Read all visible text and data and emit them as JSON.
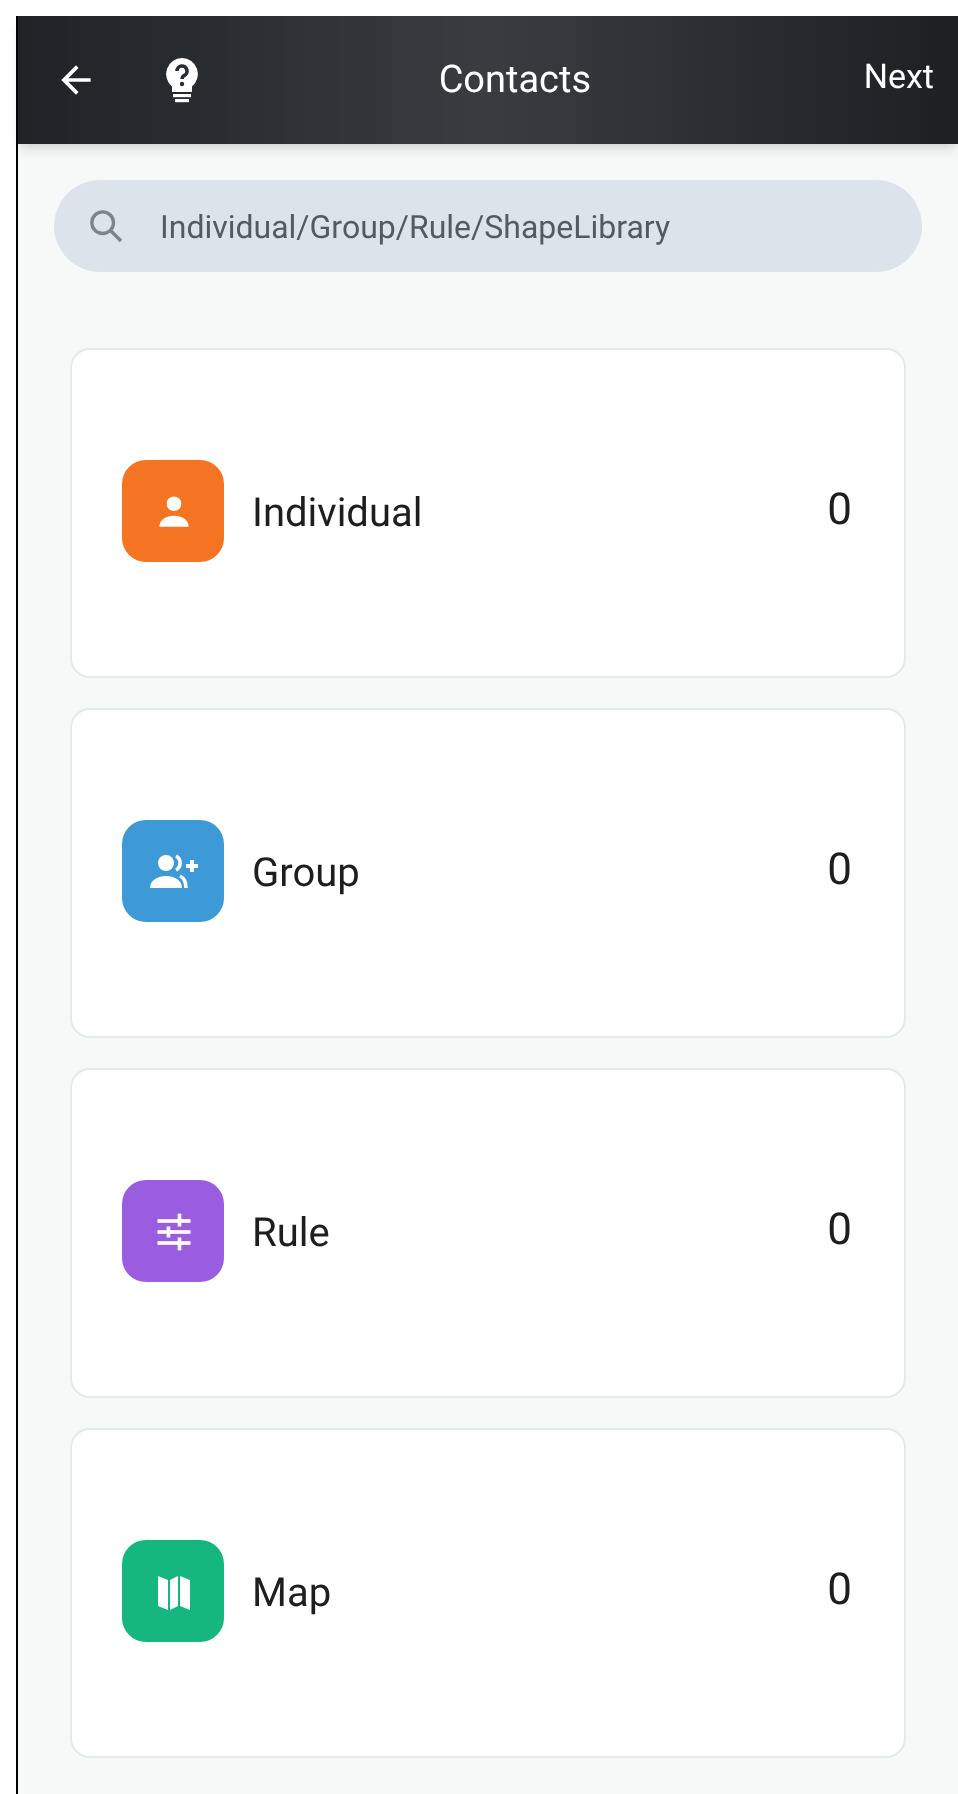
{
  "header": {
    "title": "Contacts",
    "action": "Next"
  },
  "search": {
    "placeholder": "Individual/Group/Rule/ShapeLibrary"
  },
  "categories": [
    {
      "kind": "person",
      "label": "Individual",
      "count": "0",
      "color": "#f47421"
    },
    {
      "kind": "group",
      "label": "Group",
      "count": "0",
      "color": "#3d9ad6"
    },
    {
      "kind": "rule",
      "label": "Rule",
      "count": "0",
      "color": "#9b5de0"
    },
    {
      "kind": "map",
      "label": "Map",
      "count": "0",
      "color": "#16b67f"
    }
  ]
}
